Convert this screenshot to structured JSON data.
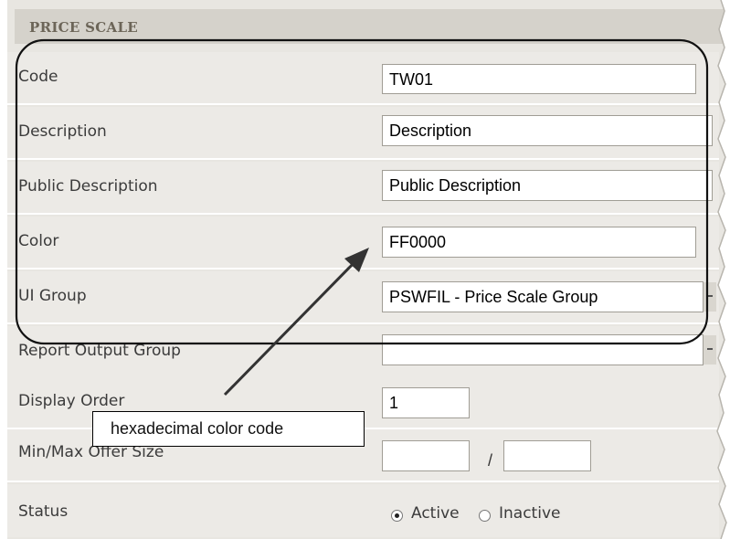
{
  "header": {
    "title": "PRICE SCALE"
  },
  "fields": {
    "code": {
      "label": "Code",
      "value": "TW01"
    },
    "description": {
      "label": "Description",
      "value": "Description"
    },
    "public_description": {
      "label": "Public Description",
      "value": "Public Description"
    },
    "color": {
      "label": "Color",
      "value": "FF0000"
    },
    "ui_group": {
      "label": "UI Group",
      "value": "PSWFIL - Price Scale Group"
    },
    "report_output_group": {
      "label": "Report Output Group",
      "value": ""
    },
    "display_order": {
      "label": "Display Order",
      "value": "1"
    },
    "min_max_offer_size": {
      "label": "Min/Max Offer Size",
      "min_value": "",
      "max_value": "",
      "separator": "/"
    },
    "status": {
      "label": "Status",
      "options": [
        "Active",
        "Inactive"
      ],
      "selected": "Active"
    }
  },
  "annotation": {
    "callout_text": "hexadecimal color code"
  }
}
